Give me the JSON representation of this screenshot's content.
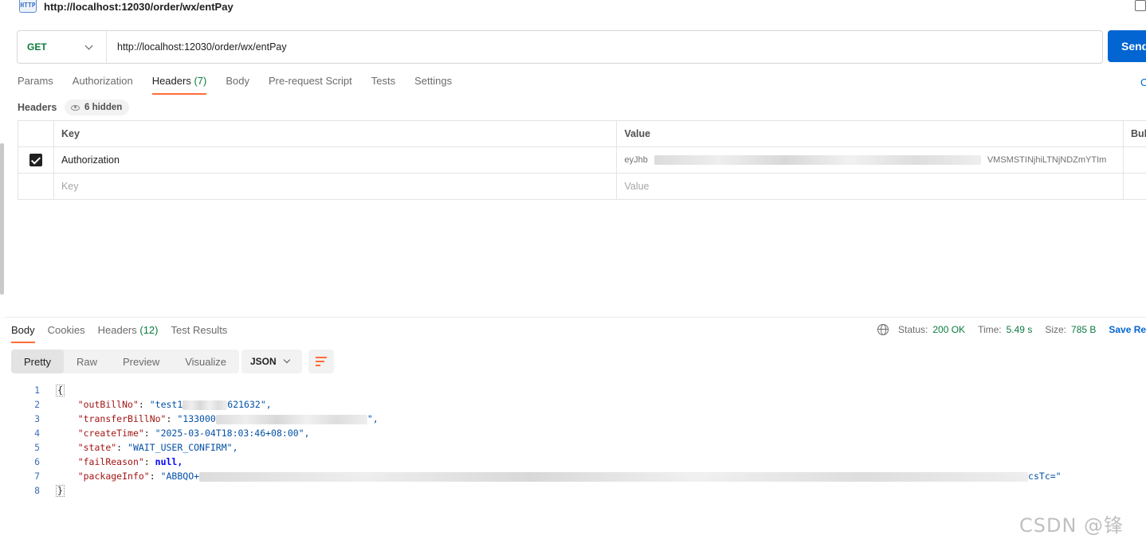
{
  "request": {
    "title": "http://localhost:12030/order/wx/entPay",
    "method": "GET",
    "url": "http://localhost:12030/order/wx/entPay",
    "send_label": "Send",
    "icon": "http-file-icon"
  },
  "req_tabs": [
    {
      "label": "Params",
      "count": ""
    },
    {
      "label": "Authorization",
      "count": ""
    },
    {
      "label": "Headers",
      "count": "(7)"
    },
    {
      "label": "Body",
      "count": ""
    },
    {
      "label": "Pre-request Script",
      "count": ""
    },
    {
      "label": "Tests",
      "count": ""
    },
    {
      "label": "Settings",
      "count": ""
    }
  ],
  "cookies_link": "C",
  "headers_section": {
    "label": "Headers",
    "hidden_label": "6 hidden",
    "columns": [
      "Key",
      "Value",
      "Bul"
    ],
    "rows": [
      {
        "checked": true,
        "key": "Authorization",
        "value_prefix": "eyJhb",
        "value_suffix": "VMSMSTINjhiLTNjNDZmYTIm"
      },
      {
        "checked": false,
        "key_placeholder": "Key",
        "value_placeholder": "Value"
      }
    ]
  },
  "response": {
    "tabs": [
      {
        "label": "Body",
        "count": ""
      },
      {
        "label": "Cookies",
        "count": ""
      },
      {
        "label": "Headers",
        "count": "(12)"
      },
      {
        "label": "Test Results",
        "count": ""
      }
    ],
    "status_label": "Status:",
    "status_value": "200 OK",
    "time_label": "Time:",
    "time_value": "5.49 s",
    "size_label": "Size:",
    "size_value": "785 B",
    "save_label": "Save Resp",
    "view_modes": [
      "Pretty",
      "Raw",
      "Preview",
      "Visualize"
    ],
    "format": "JSON"
  },
  "code_lines": [
    {
      "n": "1"
    },
    {
      "n": "2",
      "key": "\"outBillNo\"",
      "val": "\"test1",
      "tail": "621632\","
    },
    {
      "n": "3",
      "key": "\"transferBillNo\"",
      "val": "\"133000",
      "tail": "\","
    },
    {
      "n": "4",
      "key": "\"createTime\"",
      "val": "\"2025-03-04T18:03:46+08:00\","
    },
    {
      "n": "5",
      "key": "\"state\"",
      "val": "\"WAIT_USER_CONFIRM\","
    },
    {
      "n": "6",
      "key": "\"failReason\"",
      "val": "null,"
    },
    {
      "n": "7",
      "key": "\"packageInfo\"",
      "val": "\"ABBQO+",
      "tail": "csTc=\""
    },
    {
      "n": "8"
    }
  ],
  "watermark": "CSDN @锋丶/",
  "colors": {
    "accent": "#ff6c37",
    "primary": "#0265d2",
    "success": "#0b7a3e"
  }
}
